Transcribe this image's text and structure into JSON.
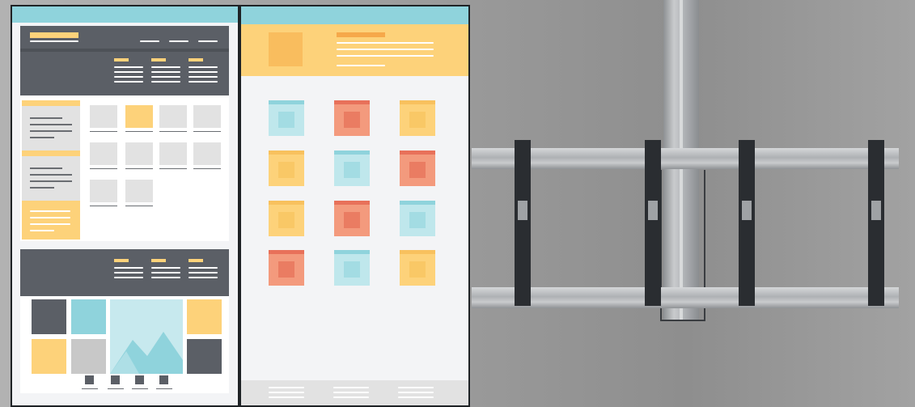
{
  "scene": {
    "description_kind": "photo-composite",
    "screens": [
      {
        "id": "left-screen",
        "content": "website-wireframe"
      },
      {
        "id": "right-screen",
        "content": "tile-grid-wireframe"
      }
    ],
    "mount": {
      "uprights": 4
    },
    "colors": {
      "teal": "#8fd3dc",
      "dark": "#5b5f66",
      "yellow": "#fdd27a",
      "orange": "#ef8b6c",
      "light": "#f3f4f6",
      "gray": "#e2e2e2",
      "wall": "#9c9c9c",
      "metal": "#b9bcbf",
      "bracket": "#2a2d31"
    },
    "tile_grid": [
      [
        "teal",
        "orange",
        "yellow"
      ],
      [
        "yellow",
        "teal",
        "orange"
      ],
      [
        "yellow",
        "orange",
        "teal"
      ],
      [
        "orange",
        "teal",
        "yellow"
      ]
    ]
  }
}
